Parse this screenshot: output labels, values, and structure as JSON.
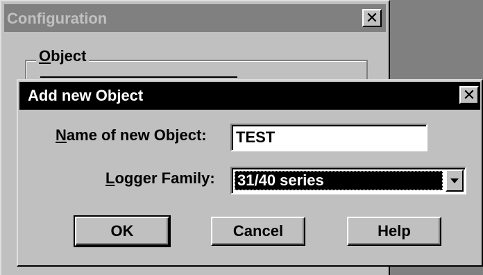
{
  "config_window": {
    "title": "Configuration",
    "close_glyph": "✕",
    "group_label_accel": "O",
    "group_label_rest": "bject"
  },
  "dialog": {
    "title": "Add new Object",
    "close_glyph": "✕",
    "name_label_accel": "N",
    "name_label_rest": "ame of new Object:",
    "name_value": "TEST",
    "family_label_accel": "L",
    "family_label_rest": "ogger Family:",
    "family_value": "31/40 series",
    "ok_label": "OK",
    "cancel_label": "Cancel",
    "help_label": "Help"
  },
  "icons": {
    "close": "close-icon",
    "dropdown": "chevron-down-icon"
  },
  "colors": {
    "face": "#c0c0c0",
    "active_title": "#000000",
    "inactive_title": "#808080",
    "selection": "#000000"
  }
}
